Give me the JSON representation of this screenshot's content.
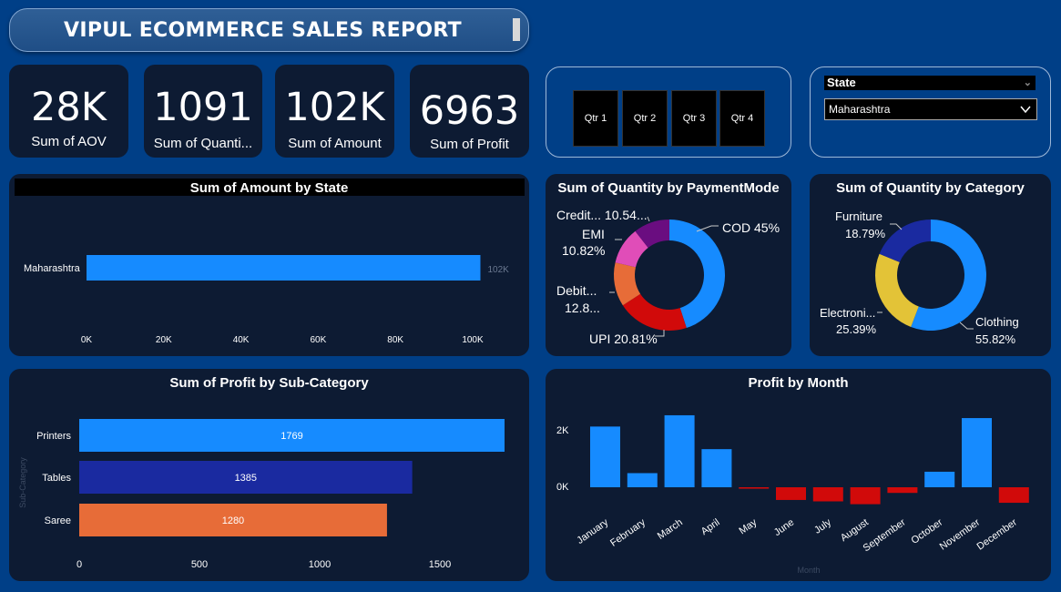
{
  "header": {
    "title": "VIPUL ECOMMERCE SALES REPORT"
  },
  "kpis": [
    {
      "value": "28K",
      "label": "Sum of AOV"
    },
    {
      "value": "1091",
      "label": "Sum of Quanti..."
    },
    {
      "value": "102K",
      "label": "Sum of Amount"
    },
    {
      "value": "6963",
      "label": "Sum of Profit"
    }
  ],
  "quarter_slicer": {
    "buttons": [
      "Qtr 1",
      "Qtr 2",
      "Qtr 3",
      "Qtr 4"
    ]
  },
  "state_slicer": {
    "label": "State",
    "selected": "Maharashtra"
  },
  "colors": {
    "background": "#003f87",
    "card": "#0d1b33",
    "blue": "#168bff",
    "navy": "#1a2aa0",
    "orange": "#e76c38",
    "red": "#d10a0a",
    "pink": "#e04db8",
    "purple": "#6a0d80",
    "yellow": "#e3c337"
  },
  "chart_data": [
    {
      "id": "amount_by_state",
      "type": "bar",
      "orientation": "horizontal",
      "title": "Sum of Amount by State",
      "categories": [
        "Maharashtra"
      ],
      "values": [
        102
      ],
      "data_labels": [
        "102K"
      ],
      "xlim": [
        0,
        100
      ],
      "x_ticks": [
        "0K",
        "20K",
        "40K",
        "60K",
        "80K",
        "100K"
      ]
    },
    {
      "id": "quantity_by_paymentmode",
      "type": "pie",
      "donut": true,
      "title": "Sum of Quantity by PaymentMode",
      "slices": [
        {
          "name": "COD",
          "value": 45,
          "label": "COD 45%",
          "color": "#168bff"
        },
        {
          "name": "UPI",
          "value": 20.81,
          "label": "UPI 20.81%",
          "color": "#d10a0a"
        },
        {
          "name": "Debit...",
          "value": 12.8,
          "label": "Debit... 12.8...",
          "color": "#e76c38"
        },
        {
          "name": "EMI",
          "value": 10.82,
          "label": "EMI 10.82%",
          "color": "#e04db8"
        },
        {
          "name": "Credit...",
          "value": 10.54,
          "label": "Credit... 10.54...",
          "color": "#6a0d80"
        }
      ]
    },
    {
      "id": "quantity_by_category",
      "type": "pie",
      "donut": true,
      "title": "Sum of Quantity by Category",
      "slices": [
        {
          "name": "Clothing",
          "value": 55.82,
          "label": "Clothing 55.82%",
          "color": "#168bff"
        },
        {
          "name": "Electronics",
          "value": 25.39,
          "label": "Electroni... 25.39%",
          "color": "#e3c337"
        },
        {
          "name": "Furniture",
          "value": 18.79,
          "label": "Furniture 18.79%",
          "color": "#1a2aa0"
        }
      ]
    },
    {
      "id": "profit_by_subcategory",
      "type": "bar",
      "orientation": "horizontal",
      "title": "Sum of Profit by Sub-Category",
      "ylabel": "Sub-Category",
      "categories": [
        "Printers",
        "Tables",
        "Saree"
      ],
      "values": [
        1769,
        1385,
        1280
      ],
      "colors": [
        "#168bff",
        "#1a2aa0",
        "#e76c38"
      ],
      "xlim": [
        0,
        1750
      ],
      "x_ticks": [
        0,
        500,
        1000,
        1500
      ]
    },
    {
      "id": "profit_by_month",
      "type": "bar",
      "title": "Profit by Month",
      "xlabel": "Month",
      "categories": [
        "January",
        "February",
        "March",
        "April",
        "May",
        "June",
        "July",
        "August",
        "September",
        "October",
        "November",
        "December"
      ],
      "values": [
        2150,
        500,
        2550,
        1350,
        -50,
        -450,
        -500,
        -600,
        -200,
        550,
        2450,
        -550
      ],
      "y_ticks": [
        "0K",
        "2K"
      ],
      "ylim": [
        -700,
        2700
      ]
    }
  ]
}
